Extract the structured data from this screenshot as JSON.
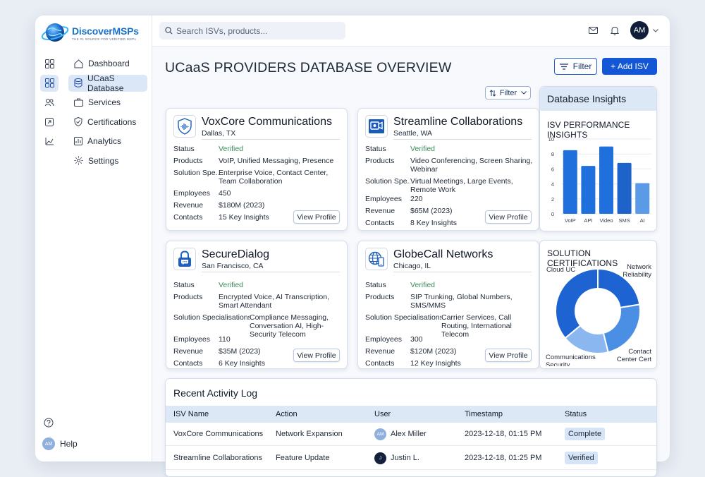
{
  "app": {
    "logo_brand": "DiscoverMSPs",
    "logo_tagline": "THE #1 SOURCE FOR VERIFIED MSPs"
  },
  "sidebar": {
    "items": [
      {
        "label": "Dashboard",
        "icon": "dashboard-icon",
        "active": false
      },
      {
        "label": "UCaaS Database",
        "icon": "database-icon",
        "active": true
      },
      {
        "label": "Services",
        "icon": "services-icon",
        "active": false
      },
      {
        "label": "Certifications",
        "icon": "shield-icon",
        "active": false
      },
      {
        "label": "Analytics",
        "icon": "analytics-icon",
        "active": false
      },
      {
        "label": "Settings",
        "icon": "settings-icon",
        "active": false
      }
    ],
    "help_label": "Help",
    "help_avatar": "AM"
  },
  "topbar": {
    "search_placeholder": "Search ISVs, products...",
    "user_initials": "AM"
  },
  "page": {
    "title": "UCaaS PROVIDERS DATABASE OVERVIEW",
    "filter_label": "Filter",
    "add_label": "+ Add ISV",
    "small_filter_label": "Filter"
  },
  "labels": {
    "status": "Status",
    "products": "Products",
    "solution_short": "Solution Spe...",
    "solution_full": "Solution Specialisations:",
    "employees": "Employees",
    "revenue": "Revenue",
    "contacts": "Contacts",
    "view_profile": "View Profile"
  },
  "cards": [
    {
      "name": "VoxCore Communications",
      "location": "Dallas, TX",
      "status": "Verified",
      "products": "VoIP, Unified Messaging, Presence",
      "solutions": "Enterprise Voice, Contact Center, Team Collaboration",
      "employees": "450",
      "revenue": "$180M (2023)",
      "contacts": "15 Key Insights"
    },
    {
      "name": "Streamline Collaborations",
      "location": "Seattle, WA",
      "status": "Verified",
      "products": "Video Conferencing, Screen Sharing, Webinar",
      "solutions": "Virtual Meetings, Large Events, Remote Work",
      "employees": "220",
      "revenue": "$65M (2023)",
      "contacts": "8 Key Insights"
    },
    {
      "name": "SecureDialog",
      "location": "San Francisco, CA",
      "status": "Verified",
      "products": "Encrypted Voice, AI Transcription, Smart Attendant",
      "solutions": "Compliance Messaging, Conversation AI, High-Security Telecom",
      "employees": "110",
      "revenue": "$35M (2023)",
      "contacts": "6 Key Insights"
    },
    {
      "name": "GlobeCall Networks",
      "location": "Chicago, IL",
      "status": "Verified",
      "products": "SIP Trunking, Global Numbers, SMS/MMS",
      "solutions": "Carrier Services, Call Routing, International Telecom",
      "employees": "300",
      "revenue": "$120M (2023)",
      "contacts": "12 Key Insights"
    }
  ],
  "insights": {
    "panel_title": "Database Insights",
    "bar_title": "ISV PERFORMANCE INSIGHTS",
    "donut_title": "SOLUTION CERTIFICATIONS"
  },
  "chart_data": [
    {
      "type": "bar",
      "title": "ISV PERFORMANCE INSIGHTS",
      "categories": [
        "VoIP",
        "API",
        "Video",
        "SMS",
        "AI"
      ],
      "values": [
        8.5,
        6.4,
        9.0,
        6.8,
        4.1
      ],
      "yticks": [
        0,
        2,
        4,
        6,
        8,
        10
      ],
      "ylim": [
        0,
        10
      ],
      "colors": [
        "#1f6fdc",
        "#1f6fdc",
        "#1f6fdc",
        "#1d63c9",
        "#5b9ae6"
      ]
    },
    {
      "type": "pie",
      "title": "SOLUTION CERTIFICATIONS",
      "labels": [
        "Network Reliability",
        "Contact Center Cert",
        "Communications Security",
        "Cloud UC"
      ],
      "values": [
        20,
        21,
        16,
        32
      ],
      "colors": [
        "#1d64d2",
        "#4b8fe5",
        "#8ab7ef",
        "#1d64d2"
      ]
    }
  ],
  "activity": {
    "title": "Recent Activity Log",
    "columns": [
      "ISV Name",
      "Action",
      "User",
      "Timestamp",
      "Status"
    ],
    "rows": [
      {
        "isv": "VoxCore Communications",
        "action": "Network Expansion",
        "user": "Alex Miller",
        "user_initials": "AM",
        "timestamp": "2023-12-18, 01:15 PM",
        "status": "Complete"
      },
      {
        "isv": "Streamline Collaborations",
        "action": "Feature Update",
        "user": "Justin L.",
        "user_initials": "J",
        "timestamp": "2023-12-18, 01:25 PM",
        "status": "Verified"
      }
    ]
  }
}
